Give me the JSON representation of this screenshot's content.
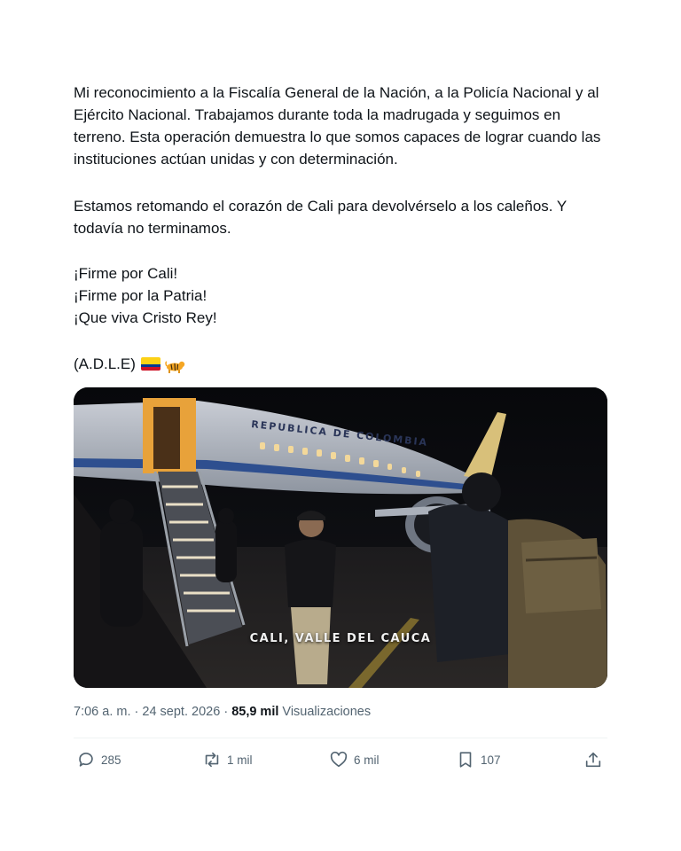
{
  "tweet": {
    "paragraph1": "Mi reconocimiento a la Fiscalía General de la Nación, a la Policía Nacional y al Ejército Nacional. Trabajamos durante toda la madrugada y seguimos en terreno. Esta operación demuestra lo que somos capaces de lograr cuando las instituciones actúan unidas y con determinación.",
    "paragraph2": "Estamos retomando el corazón de Cali para devolvérselo a los caleños. Y todavía no terminamos.",
    "line1": "¡Firme por Cali!",
    "line2": "¡Firme por la Patria!",
    "line3": "¡Que viva Cristo Rey!",
    "signature": "(A.D.L.E)",
    "emojis": [
      "colombia-flag",
      "tiger"
    ]
  },
  "media": {
    "caption": "CALI, VALLE DEL CAUCA",
    "plane_text": "REPUBLICA DE COLOMBIA"
  },
  "meta": {
    "time": "7:06 a. m.",
    "separator": "·",
    "date": "24 sept. 2026",
    "views_count": "85,9 mil",
    "views_label": "Visualizaciones"
  },
  "actions": {
    "replies": "285",
    "reposts": "1 mil",
    "likes": "6 mil",
    "bookmarks": "107"
  },
  "colors": {
    "text": "#0f1419",
    "secondary": "#536471",
    "divider": "#eff3f4"
  }
}
